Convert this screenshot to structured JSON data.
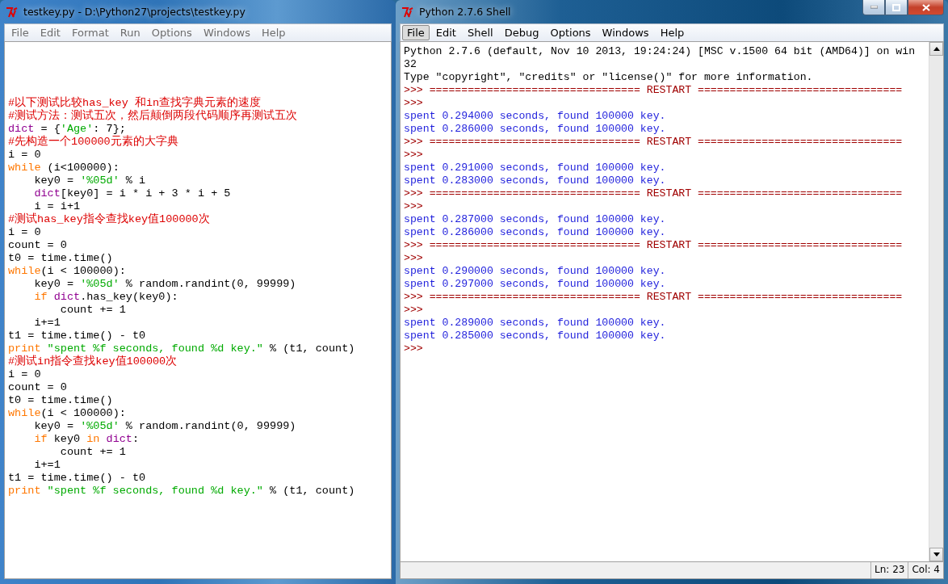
{
  "editor": {
    "title": "testkey.py - D:\\Python27\\projects\\testkey.py",
    "menu": [
      "File",
      "Edit",
      "Format",
      "Run",
      "Options",
      "Windows",
      "Help"
    ],
    "lines": [
      {
        "tokens": [
          {
            "kind": "comment",
            "text": "#以下测试比较has_key 和in查找字典元素的速度"
          }
        ]
      },
      {
        "tokens": [
          {
            "kind": "comment",
            "text": "#测试方法：测试五次，然后颠倒两段代码顺序再测试五次"
          }
        ]
      },
      {
        "tokens": [
          {
            "kind": "builtin",
            "text": "dict"
          },
          {
            "kind": "plain",
            "text": " = {"
          },
          {
            "kind": "string",
            "text": "'Age'"
          },
          {
            "kind": "plain",
            "text": ": 7};"
          }
        ]
      },
      {
        "tokens": [
          {
            "kind": "comment",
            "text": "#先构造一个100000元素的大字典"
          }
        ]
      },
      {
        "tokens": [
          {
            "kind": "plain",
            "text": "i = 0"
          }
        ]
      },
      {
        "tokens": [
          {
            "kind": "keyword",
            "text": "while"
          },
          {
            "kind": "plain",
            "text": " (i<100000):"
          }
        ]
      },
      {
        "tokens": [
          {
            "kind": "plain",
            "text": "    key0 = "
          },
          {
            "kind": "string",
            "text": "'%05d'"
          },
          {
            "kind": "plain",
            "text": " % i"
          }
        ]
      },
      {
        "tokens": [
          {
            "kind": "builtin",
            "text": "    dict"
          },
          {
            "kind": "plain",
            "text": "[key0] = i * i + 3 * i + 5"
          }
        ]
      },
      {
        "tokens": [
          {
            "kind": "plain",
            "text": "    i = i+1"
          }
        ]
      },
      {
        "tokens": [
          {
            "kind": "comment",
            "text": "#测试has_key指令查找key值100000次"
          }
        ]
      },
      {
        "tokens": [
          {
            "kind": "plain",
            "text": "i = 0"
          }
        ]
      },
      {
        "tokens": [
          {
            "kind": "plain",
            "text": "count = 0"
          }
        ]
      },
      {
        "tokens": [
          {
            "kind": "plain",
            "text": "t0 = time.time()"
          }
        ]
      },
      {
        "tokens": [
          {
            "kind": "keyword",
            "text": "while"
          },
          {
            "kind": "plain",
            "text": "(i < 100000):"
          }
        ]
      },
      {
        "tokens": [
          {
            "kind": "plain",
            "text": "    key0 = "
          },
          {
            "kind": "string",
            "text": "'%05d'"
          },
          {
            "kind": "plain",
            "text": " % random.randint(0, 99999)"
          }
        ]
      },
      {
        "tokens": [
          {
            "kind": "keyword",
            "text": "    if "
          },
          {
            "kind": "builtin",
            "text": "dict"
          },
          {
            "kind": "plain",
            "text": ".has_key(key0):"
          }
        ]
      },
      {
        "tokens": [
          {
            "kind": "plain",
            "text": "        count += 1"
          }
        ]
      },
      {
        "tokens": [
          {
            "kind": "plain",
            "text": "    i+=1"
          }
        ]
      },
      {
        "tokens": [
          {
            "kind": "plain",
            "text": "t1 = time.time() - t0"
          }
        ]
      },
      {
        "tokens": [
          {
            "kind": "keyword",
            "text": "print "
          },
          {
            "kind": "string",
            "text": "\"spent %f seconds, found %d key.\""
          },
          {
            "kind": "plain",
            "text": " % (t1, count)"
          }
        ]
      },
      {
        "tokens": [
          {
            "kind": "comment",
            "text": "#测试in指令查找key值100000次"
          }
        ]
      },
      {
        "tokens": [
          {
            "kind": "plain",
            "text": "i = 0"
          }
        ]
      },
      {
        "tokens": [
          {
            "kind": "plain",
            "text": "count = 0"
          }
        ]
      },
      {
        "tokens": [
          {
            "kind": "plain",
            "text": "t0 = time.time()"
          }
        ]
      },
      {
        "tokens": [
          {
            "kind": "keyword",
            "text": "while"
          },
          {
            "kind": "plain",
            "text": "(i < 100000):"
          }
        ]
      },
      {
        "tokens": [
          {
            "kind": "plain",
            "text": "    key0 = "
          },
          {
            "kind": "string",
            "text": "'%05d'"
          },
          {
            "kind": "plain",
            "text": " % random.randint(0, 99999)"
          }
        ]
      },
      {
        "tokens": [
          {
            "kind": "keyword",
            "text": "    if "
          },
          {
            "kind": "plain",
            "text": "key0 "
          },
          {
            "kind": "keyword",
            "text": "in "
          },
          {
            "kind": "builtin",
            "text": "dict"
          },
          {
            "kind": "plain",
            "text": ":"
          }
        ]
      },
      {
        "tokens": [
          {
            "kind": "plain",
            "text": "        count += 1"
          }
        ]
      },
      {
        "tokens": [
          {
            "kind": "plain",
            "text": "    i+=1"
          }
        ]
      },
      {
        "tokens": [
          {
            "kind": "plain",
            "text": "t1 = time.time() - t0"
          }
        ]
      },
      {
        "tokens": [
          {
            "kind": "keyword",
            "text": "print "
          },
          {
            "kind": "string",
            "text": "\"spent %f seconds, found %d key.\""
          },
          {
            "kind": "plain",
            "text": " % (t1, count)"
          }
        ]
      }
    ]
  },
  "shell": {
    "title": "Python 2.7.6 Shell",
    "menu": [
      {
        "label": "File",
        "selected": true
      },
      {
        "label": "Edit",
        "selected": false
      },
      {
        "label": "Shell",
        "selected": false
      },
      {
        "label": "Debug",
        "selected": false
      },
      {
        "label": "Options",
        "selected": false
      },
      {
        "label": "Windows",
        "selected": false
      },
      {
        "label": "Help",
        "selected": false
      }
    ],
    "lines": [
      {
        "kind": "plain",
        "text": "Python 2.7.6 (default, Nov 10 2013, 19:24:24) [MSC v.1500 64 bit (AMD64)] on win"
      },
      {
        "kind": "plain",
        "text": "32"
      },
      {
        "kind": "plain",
        "text": "Type \"copyright\", \"credits\" or \"license()\" for more information."
      },
      {
        "kind": "prompt",
        "text": ">>> ================================= RESTART ================================"
      },
      {
        "kind": "prompt",
        "text": ">>>"
      },
      {
        "kind": "output",
        "text": "spent 0.294000 seconds, found 100000 key."
      },
      {
        "kind": "output",
        "text": "spent 0.286000 seconds, found 100000 key."
      },
      {
        "kind": "prompt",
        "text": ">>> ================================= RESTART ================================"
      },
      {
        "kind": "prompt",
        "text": ">>>"
      },
      {
        "kind": "output",
        "text": "spent 0.291000 seconds, found 100000 key."
      },
      {
        "kind": "output",
        "text": "spent 0.283000 seconds, found 100000 key."
      },
      {
        "kind": "prompt",
        "text": ">>> ================================= RESTART ================================"
      },
      {
        "kind": "prompt",
        "text": ">>>"
      },
      {
        "kind": "output",
        "text": "spent 0.287000 seconds, found 100000 key."
      },
      {
        "kind": "output",
        "text": "spent 0.286000 seconds, found 100000 key."
      },
      {
        "kind": "prompt",
        "text": ">>> ================================= RESTART ================================"
      },
      {
        "kind": "prompt",
        "text": ">>>"
      },
      {
        "kind": "output",
        "text": "spent 0.290000 seconds, found 100000 key."
      },
      {
        "kind": "output",
        "text": "spent 0.297000 seconds, found 100000 key."
      },
      {
        "kind": "prompt",
        "text": ">>> ================================= RESTART ================================"
      },
      {
        "kind": "prompt",
        "text": ">>>"
      },
      {
        "kind": "output",
        "text": "spent 0.289000 seconds, found 100000 key."
      },
      {
        "kind": "output",
        "text": "spent 0.285000 seconds, found 100000 key."
      },
      {
        "kind": "prompt",
        "text": ">>>"
      }
    ],
    "status": {
      "line": "Ln: 23",
      "col": "Col: 4"
    }
  }
}
